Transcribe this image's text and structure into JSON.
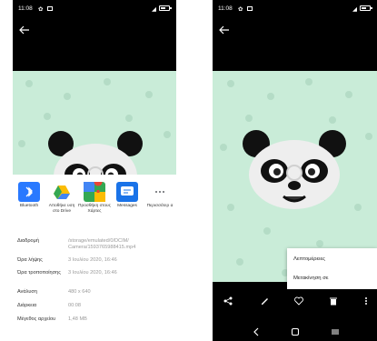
{
  "status": {
    "time": "11:08"
  },
  "share": {
    "apps": [
      {
        "label": "Bluetooth",
        "icon": "bluetooth-icon",
        "color": "#2979ff"
      },
      {
        "label": "Αποθήκε υση στο Drive",
        "icon": "google-drive-icon",
        "color": "#fbbc04"
      },
      {
        "label": "Προσθήκη στους Χάρτες",
        "icon": "google-maps-icon",
        "color": "#34a853"
      },
      {
        "label": "Messages",
        "icon": "messages-icon",
        "color": "#1a73e8"
      },
      {
        "label": "Περισσότερ α",
        "icon": "more-horizontal-icon",
        "color": "#5f6368"
      }
    ]
  },
  "details": [
    {
      "key": "Διαδρομή",
      "value": "/storage/emulated/0/DCIM/ Camera/1593765988415.mp4"
    },
    {
      "key": "Ώρα λήψης",
      "value": "3 Ιουλίου 2020, 16:46"
    },
    {
      "key": "Ώρα τροποποίησης",
      "value": "3 Ιουλίου 2020, 16:46"
    },
    {
      "key": "Ανάλυση",
      "value": "480 x 640"
    },
    {
      "key": "Διάρκεια",
      "value": "00:08"
    },
    {
      "key": "Μέγεθος αρχείου",
      "value": "1,48 MB"
    }
  ],
  "menu": {
    "items": [
      "Λεπτομέρειες",
      "Μετακίνηση σε"
    ]
  },
  "colors": {
    "photo_bg": "#c9ecd8",
    "paw": "#b4dcc6"
  }
}
